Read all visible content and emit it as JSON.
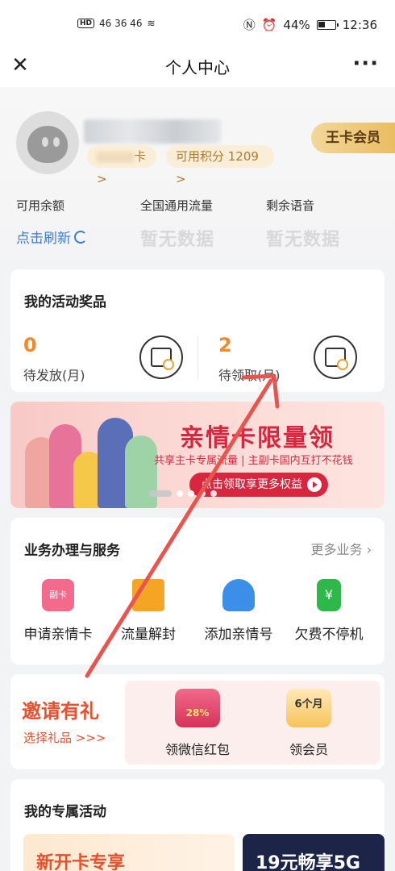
{
  "status_bar": {
    "network": "46 36 46",
    "battery": "44%",
    "battery_level": 0.44,
    "time": "12:36"
  },
  "nav": {
    "title": "个人中心"
  },
  "profile": {
    "card_chip": "卡 >",
    "points_chip": "可用积分 1209 >",
    "vip_badge": "王卡会员"
  },
  "stats": [
    {
      "label": "可用余额",
      "value": "点击刷新"
    },
    {
      "label": "全国通用流量",
      "value": "暂无数据"
    },
    {
      "label": "剩余语音",
      "value": "暂无数据"
    }
  ],
  "prizes": {
    "title": "我的活动奖品",
    "items": [
      {
        "count": "0",
        "label": "待发放(月)",
        "icon": "gift-box-clock-icon"
      },
      {
        "count": "2",
        "label": "待领取(月)",
        "icon": "gift-clock-icon"
      }
    ]
  },
  "banner": {
    "title": "亲情卡限量领",
    "subtitle": "共享主卡专属流量 | 主副卡国内互打不花钱",
    "button": "点击领取享更多权益"
  },
  "services": {
    "title": "业务办理与服务",
    "more": "更多业务",
    "items": [
      {
        "label": "申请亲情卡",
        "icon": "sim-card-icon",
        "color": "#f46a8c"
      },
      {
        "label": "流量解封",
        "icon": "data-unlock-icon",
        "color": "#f5a524"
      },
      {
        "label": "添加亲情号",
        "icon": "add-contact-icon",
        "color": "#3b8fe8"
      },
      {
        "label": "欠费不停机",
        "icon": "phone-yuan-icon",
        "color": "#2fb84a"
      }
    ]
  },
  "invite": {
    "title": "邀请有礼",
    "subtitle": "选择礼品 >>>",
    "gifts": [
      {
        "label": "领微信红包",
        "badge": "28%",
        "icon": "red-envelope-icon"
      },
      {
        "label": "领会员",
        "badge": "6个月",
        "icon": "membership-gift-icon"
      }
    ]
  },
  "activities": {
    "title": "我的专属活动",
    "cards": [
      {
        "text": "新开卡专享"
      },
      {
        "text": "19元畅享5G"
      }
    ]
  }
}
